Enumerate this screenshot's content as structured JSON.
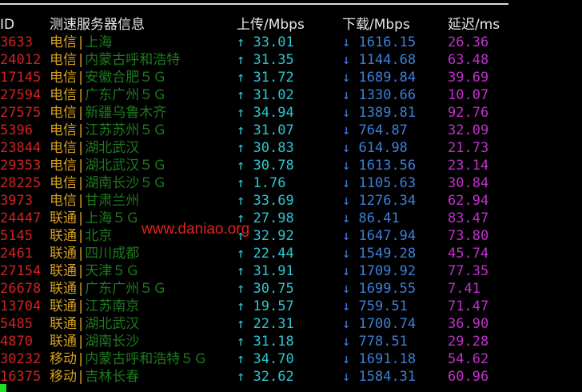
{
  "header": {
    "id": "ID",
    "name": "测速服务器信息",
    "upload": "上传/Mbps",
    "download": "下载/Mbps",
    "latency": "延迟/ms"
  },
  "glyphs": {
    "separator": "|",
    "up_arrow": "↑",
    "down_arrow": "↓"
  },
  "rows": [
    {
      "id": "3633",
      "isp": "电信",
      "city": "上海",
      "upload": "33.01",
      "download": "1616.15",
      "latency": "26.36"
    },
    {
      "id": "24012",
      "isp": "电信",
      "city": "内蒙古呼和浩特",
      "upload": "31.35",
      "download": "1144.68",
      "latency": "63.48"
    },
    {
      "id": "17145",
      "isp": "电信",
      "city": "安徽合肥５Ｇ",
      "upload": "31.72",
      "download": "1689.84",
      "latency": "39.69"
    },
    {
      "id": "27594",
      "isp": "电信",
      "city": "广东广州５Ｇ",
      "upload": "31.02",
      "download": "1330.66",
      "latency": "10.07"
    },
    {
      "id": "27575",
      "isp": "电信",
      "city": "新疆乌鲁木齐",
      "upload": "34.94",
      "download": "1389.81",
      "latency": "92.76"
    },
    {
      "id": "5396",
      "isp": "电信",
      "city": "江苏苏州５Ｇ",
      "upload": "31.07",
      "download": "764.87",
      "latency": "32.09"
    },
    {
      "id": "23844",
      "isp": "电信",
      "city": "湖北武汉",
      "upload": "30.83",
      "download": "614.98",
      "latency": "21.73"
    },
    {
      "id": "29353",
      "isp": "电信",
      "city": "湖北武汉５Ｇ",
      "upload": "30.78",
      "download": "1613.56",
      "latency": "23.14"
    },
    {
      "id": "28225",
      "isp": "电信",
      "city": "湖南长沙５Ｇ",
      "upload": "1.76",
      "download": "1105.63",
      "latency": "30.84"
    },
    {
      "id": "3973",
      "isp": "电信",
      "city": "甘肃兰州",
      "upload": "33.69",
      "download": "1276.34",
      "latency": "62.94"
    },
    {
      "id": "24447",
      "isp": "联通",
      "city": "上海５Ｇ",
      "upload": "27.98",
      "download": "86.41",
      "latency": "83.47"
    },
    {
      "id": "5145",
      "isp": "联通",
      "city": "北京",
      "upload": "32.92",
      "download": "1647.94",
      "latency": "73.80"
    },
    {
      "id": "2461",
      "isp": "联通",
      "city": "四川成都",
      "upload": "22.44",
      "download": "1549.28",
      "latency": "45.74"
    },
    {
      "id": "27154",
      "isp": "联通",
      "city": "天津５Ｇ",
      "upload": "31.91",
      "download": "1709.92",
      "latency": "77.35"
    },
    {
      "id": "26678",
      "isp": "联通",
      "city": "广东广州５Ｇ",
      "upload": "30.75",
      "download": "1699.55",
      "latency": "7.41"
    },
    {
      "id": "13704",
      "isp": "联通",
      "city": "江苏南京",
      "upload": "19.57",
      "download": "759.51",
      "latency": "71.47"
    },
    {
      "id": "5485",
      "isp": "联通",
      "city": "湖北武汉",
      "upload": "22.31",
      "download": "1700.74",
      "latency": "36.90"
    },
    {
      "id": "4870",
      "isp": "联通",
      "city": "湖南长沙",
      "upload": "31.18",
      "download": "778.51",
      "latency": "29.28"
    },
    {
      "id": "30232",
      "isp": "移动",
      "city": "内蒙古呼和浩特５Ｇ",
      "upload": "34.70",
      "download": "1691.18",
      "latency": "54.62"
    },
    {
      "id": "16375",
      "isp": "移动",
      "city": "吉林长春",
      "upload": "32.62",
      "download": "1584.31",
      "latency": "60.96"
    }
  ],
  "watermark": "www.daniao.org",
  "colors": {
    "background": "#000000",
    "id": "#d02222",
    "isp": "#d4a020",
    "city": "#1e7a1e",
    "upload": "#2fc6cf",
    "download": "#3d7fd8",
    "latency": "#c030c8",
    "watermark": "#e42020",
    "cursor": "#22dd22"
  }
}
